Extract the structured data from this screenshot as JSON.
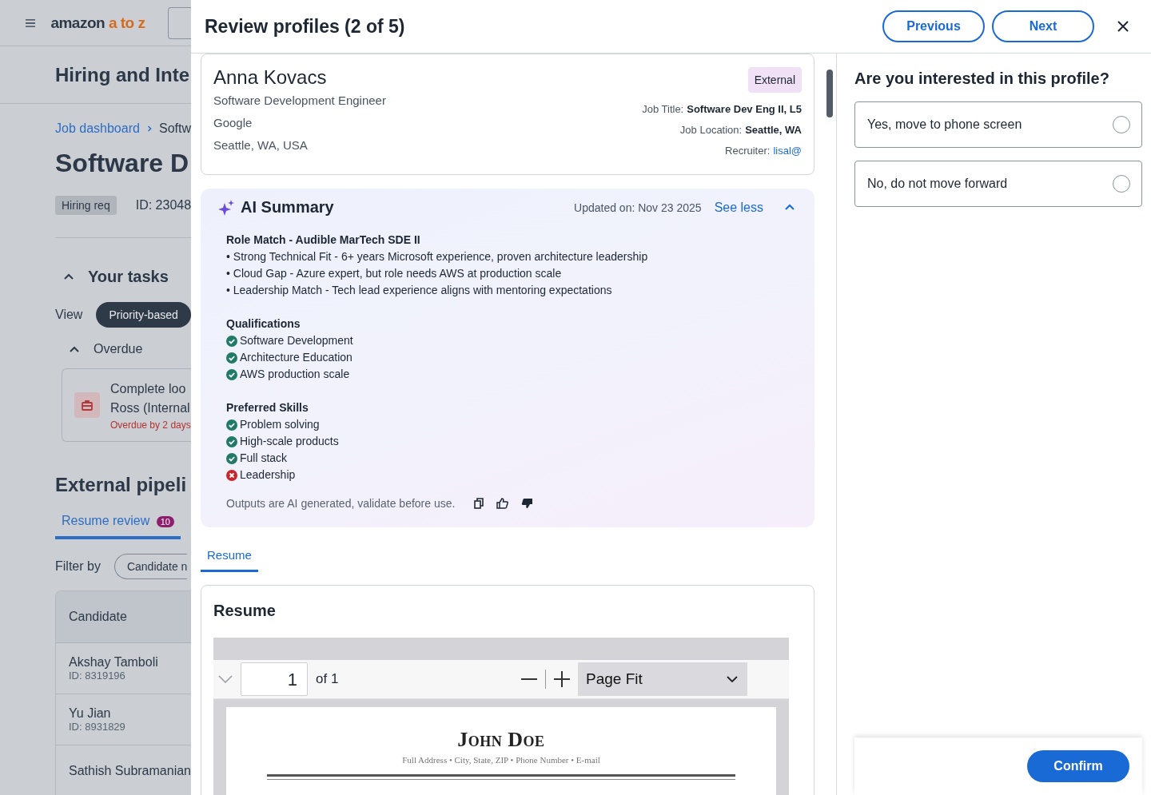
{
  "background_page": {
    "header": {
      "logo": {
        "brand": "amazon",
        "suffix": "a to z"
      }
    },
    "page_title": "Hiring and Inte",
    "breadcrumb": [
      {
        "label": "Job dashboard",
        "kind": "link"
      },
      {
        "label": "Softw",
        "kind": "current"
      }
    ],
    "job_title": "Software D",
    "tag": "Hiring req",
    "req_id": "ID: 23048",
    "tasks": {
      "title": "Your tasks",
      "expanded": true,
      "view_label": "View",
      "view_options": [
        {
          "label": "Priority-based",
          "selected": true
        }
      ],
      "groups": [
        {
          "title": "Overdue",
          "expanded": true,
          "tasks": [
            {
              "lines": [
                "Complete loo",
                "Ross (Internal"
              ],
              "due": "Overdue by 2 days"
            }
          ]
        }
      ]
    },
    "pipeline": {
      "title": "External pipeli",
      "tabs": [
        {
          "label": "Resume review",
          "count": "10",
          "selected": true
        }
      ],
      "filter_label": "Filter by",
      "filters": [
        "Candidate n"
      ],
      "table": {
        "columns": [
          "Candidate"
        ],
        "rows": [
          {
            "name": "Akshay Tamboli",
            "id": "ID: 8319196"
          },
          {
            "name": "Yu Jian",
            "id": "ID: 8931829"
          },
          {
            "name": "Sathish Subramanian"
          }
        ]
      }
    }
  },
  "modal": {
    "title": "Review profiles (2 of 5)",
    "buttons": [
      "Previous",
      "Next"
    ],
    "candidate": {
      "name": "Anna Kovacs",
      "role": "Software Development Engineer",
      "company": "Google",
      "location": "Seattle, WA, USA",
      "tag": "External",
      "details": [
        {
          "label": "Job Title:",
          "value": "Software Dev Eng II, L5",
          "kind": "text"
        },
        {
          "label": "Job Location:",
          "value": "Seattle, WA",
          "kind": "text"
        },
        {
          "label": "Recruiter:",
          "value": "lisal@",
          "kind": "link"
        }
      ]
    },
    "ai_summary": {
      "title": "AI Summary",
      "updated": "Updated on: Nov 23 2025",
      "toggle": "See less",
      "expanded": true,
      "sections": [
        {
          "title": "Role Match - Audible MarTech SDE II",
          "kind": "bullets",
          "items": [
            {
              "text": "• Strong Technical Fit - 6+ years Microsoft experience, proven architecture leadership"
            },
            {
              "text": "• Cloud Gap - Azure expert, but role needs AWS at production scale"
            },
            {
              "text": "• Leadership Match - Tech lead experience aligns with mentoring expectations"
            }
          ]
        },
        {
          "title": "Qualifications",
          "kind": "checks",
          "items": [
            {
              "text": "Software Development",
              "met": true
            },
            {
              "text": "Architecture Education",
              "met": true
            },
            {
              "text": "AWS production scale",
              "met": true
            }
          ]
        },
        {
          "title": "Preferred Skills",
          "kind": "checks",
          "items": [
            {
              "text": "Problem solving",
              "met": true
            },
            {
              "text": "High-scale products",
              "met": true
            },
            {
              "text": "Full stack",
              "met": true
            },
            {
              "text": "Leadership",
              "met": false
            }
          ]
        }
      ],
      "disclaimer": "Outputs are AI generated, validate before use."
    },
    "tabs": [
      {
        "label": "Resume",
        "selected": true
      }
    ],
    "resume": {
      "title": "Resume",
      "viewer": {
        "page": "1",
        "page_count": "of 1",
        "zoom": "Page Fit"
      },
      "document": {
        "name": "John Doe",
        "contact": "Full Address • City, State, ZIP • Phone Number • E-mail"
      }
    },
    "question": {
      "title": "Are you interested in this profile?",
      "options": [
        {
          "label": "Yes, move to phone screen",
          "selected": false
        },
        {
          "label": "No, do not move forward",
          "selected": false
        }
      ]
    },
    "confirm": "Confirm"
  }
}
